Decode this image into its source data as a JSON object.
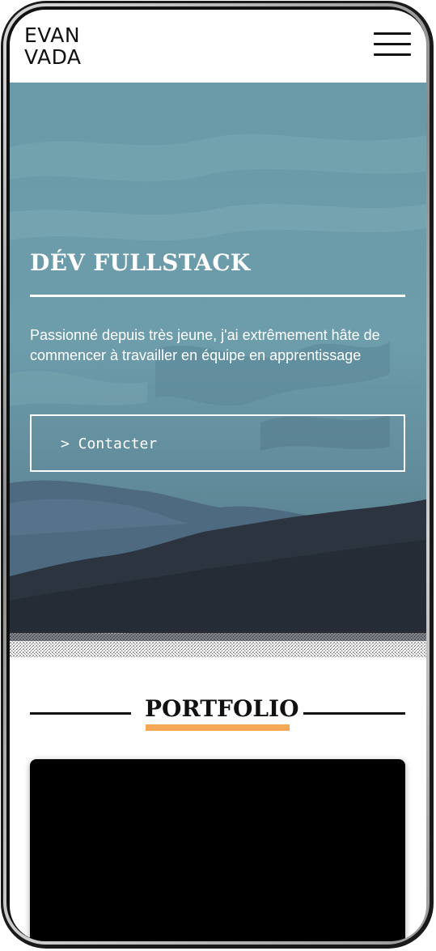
{
  "header": {
    "logo_line1": "EVAN",
    "logo_line2": "VADA",
    "menu_icon": "hamburger-menu-icon"
  },
  "hero": {
    "title": "DÉV FULLSTACK",
    "description": "Passionné depuis très jeune, j'ai extrêmement hâte de commencer à travailler en équipe en apprentissage",
    "contact_label": "> Contacter"
  },
  "portfolio": {
    "title": "PORTFOLIO"
  },
  "colors": {
    "sky": "#6a9aa8",
    "mountains_dark": "#2c3440",
    "accent_underline": "#f5a957",
    "card": "#000000"
  }
}
